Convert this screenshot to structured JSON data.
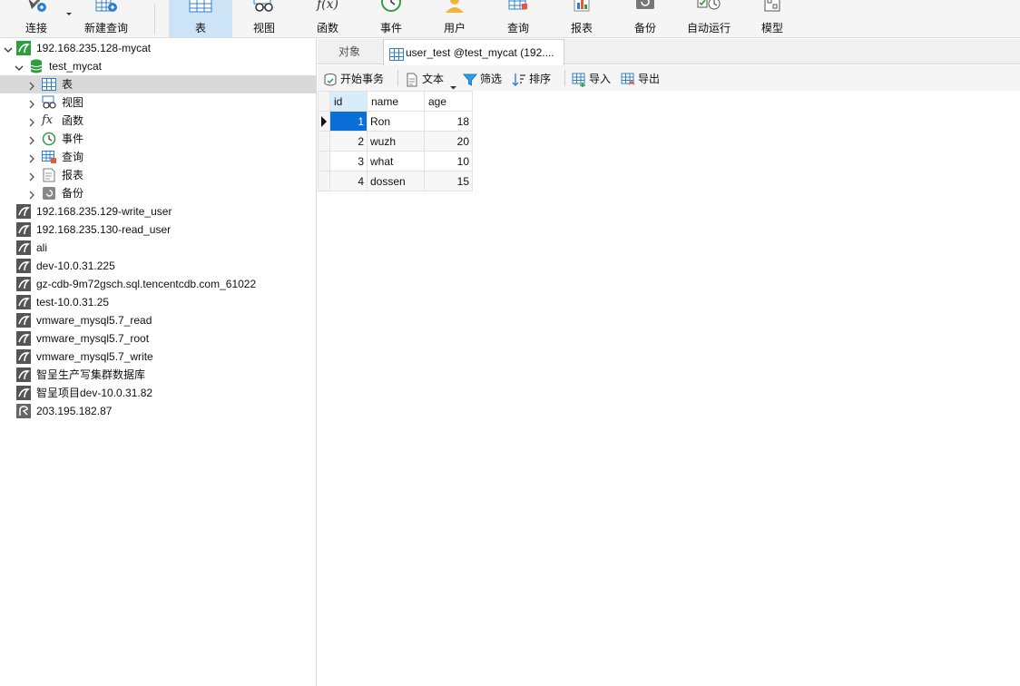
{
  "toolbar": {
    "connect_label": "连接",
    "new_query_label": "新建查询",
    "table_label": "表",
    "view_label": "视图",
    "function_label": "函数",
    "event_label": "事件",
    "user_label": "用户",
    "query_label": "查询",
    "report_label": "报表",
    "backup_label": "备份",
    "automation_label": "自动运行",
    "model_label": "模型",
    "function_icon_text": "f(x)",
    "active": "表"
  },
  "tree": {
    "connection": "192.168.235.128-mycat",
    "database": "test_mycat",
    "items": [
      {
        "label": "表",
        "icon": "table-icon"
      },
      {
        "label": "视图",
        "icon": "view-icon"
      },
      {
        "label": "函数",
        "icon": "function-icon"
      },
      {
        "label": "事件",
        "icon": "event-icon"
      },
      {
        "label": "查询",
        "icon": "query-icon"
      },
      {
        "label": "报表",
        "icon": "report-icon"
      },
      {
        "label": "备份",
        "icon": "backup-icon"
      }
    ],
    "fx_text": "fx",
    "connections": [
      "192.168.235.129-write_user",
      "192.168.235.130-read_user",
      "ali",
      "dev-10.0.31.225",
      "gz-cdb-9m72gsch.sql.tencentcdb.com_61022",
      "test-10.0.31.25",
      "vmware_mysql5.7_read",
      "vmware_mysql5.7_root",
      "vmware_mysql5.7_write",
      "智呈生产写集群数据库",
      "智呈项目dev-10.0.31.82",
      "203.195.182.87"
    ]
  },
  "tabs": {
    "objects": "对象",
    "active": "user_test @test_mycat (192...."
  },
  "grid_toolbar": {
    "begin_transaction": "开始事务",
    "text": "文本",
    "filter": "筛选",
    "sort": "排序",
    "import": "导入",
    "export": "导出"
  },
  "table": {
    "columns": [
      "id",
      "name",
      "age"
    ],
    "rows": [
      {
        "id": "1",
        "name": "Ron",
        "age": "18"
      },
      {
        "id": "2",
        "name": "wuzh",
        "age": "20"
      },
      {
        "id": "3",
        "name": "what",
        "age": "10"
      },
      {
        "id": "4",
        "name": "dossen",
        "age": "15"
      }
    ]
  },
  "colors": {
    "accent": "#0a6fd6",
    "selected_tab": "#cde4f7",
    "mysql_icon": "#2e9e3e"
  }
}
